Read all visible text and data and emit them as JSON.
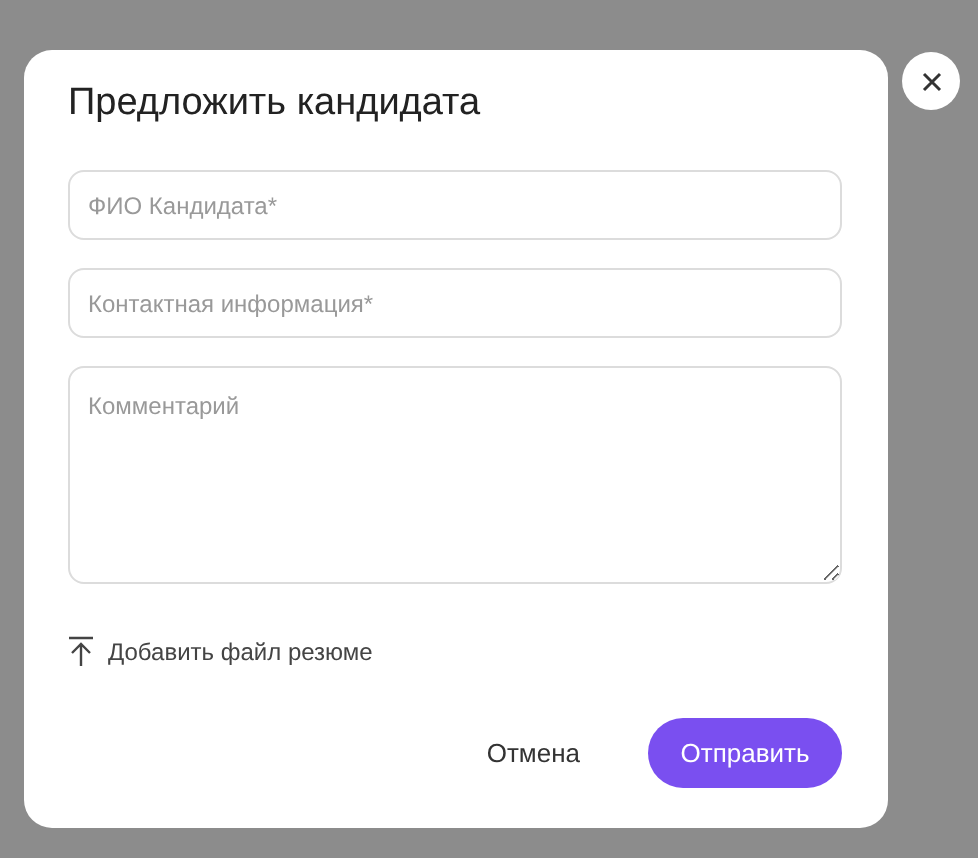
{
  "dialog": {
    "title": "Предложить кандидата",
    "fields": [
      {
        "kind": "input",
        "placeholder": "ФИО Кандидата*"
      },
      {
        "kind": "input",
        "placeholder": "Контактная информация*"
      },
      {
        "kind": "textarea",
        "placeholder": "Комментарий"
      }
    ],
    "attach_link": "Добавить файл резюме",
    "buttons": [
      {
        "kind": "secondary",
        "label": "Отмена"
      },
      {
        "kind": "primary",
        "label": "Отправить"
      }
    ]
  }
}
